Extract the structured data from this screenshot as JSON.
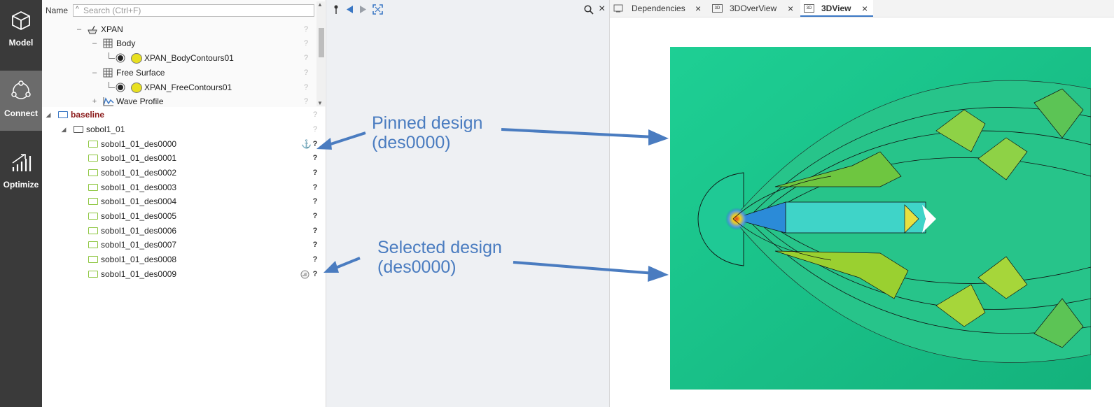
{
  "nav": {
    "items": [
      {
        "label": "Model",
        "icon": "cube-icon"
      },
      {
        "label": "Connect",
        "icon": "connect-icon"
      },
      {
        "label": "Optimize",
        "icon": "optimize-icon"
      }
    ],
    "active": "Connect"
  },
  "tree": {
    "name_label": "Name",
    "search_placeholder": "Search (Ctrl+F)",
    "upper_rows": [
      {
        "label": "XPAN",
        "toggle": "–",
        "icon": "xpan-icon"
      },
      {
        "label": "Body",
        "toggle": "–",
        "icon": "grid-icon"
      },
      {
        "label": "XPAN_BodyContours01",
        "icon": "contour-icon"
      },
      {
        "label": "Free Surface",
        "toggle": "–",
        "icon": "grid-icon"
      },
      {
        "label": "XPAN_FreeContours01",
        "icon": "contour-icon"
      },
      {
        "label": "Wave Profile",
        "toggle": "+",
        "icon": "wave-profile-icon"
      }
    ],
    "baseline": "baseline",
    "group": "sobol1_01",
    "designs": [
      "sobol1_01_des0000",
      "sobol1_01_des0001",
      "sobol1_01_des0002",
      "sobol1_01_des0003",
      "sobol1_01_des0004",
      "sobol1_01_des0005",
      "sobol1_01_des0006",
      "sobol1_01_des0007",
      "sobol1_01_des0008",
      "sobol1_01_des0009"
    ],
    "status": "?"
  },
  "toolbar": {
    "pin": "pin-icon",
    "back": "triangle-left-icon",
    "forward": "triangle-right-icon",
    "fit": "fit-icon",
    "search": "search-icon",
    "close": "×"
  },
  "tabs": [
    {
      "label": "Dependencies",
      "close": "×"
    },
    {
      "label": "3DOverView",
      "close": "×"
    },
    {
      "label": "3DView",
      "close": "×",
      "active": true
    }
  ],
  "annotations": {
    "pinned": {
      "line1": "Pinned design",
      "line2": "(des0000)"
    },
    "selected": {
      "line1": "Selected design",
      "line2": "(des0000)"
    }
  },
  "colors": {
    "accent": "#3a77c4",
    "annotation": "#4a7cc0",
    "nav_bg": "#3a3a3a",
    "nav_active": "#6b6b6b",
    "folder": "#8dc63f",
    "baseline": "#8b1a1a"
  }
}
